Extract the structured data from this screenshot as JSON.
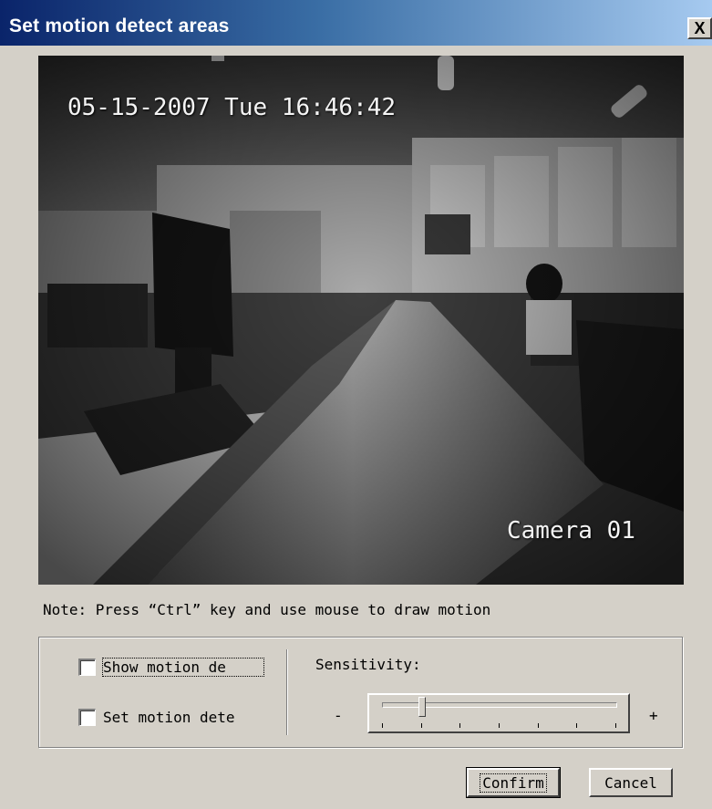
{
  "window": {
    "title": "Set motion detect areas",
    "close_label": "X"
  },
  "video": {
    "timestamp": "05-15-2007 Tue 16:46:42",
    "camera_label": "Camera 01"
  },
  "note": "Note: Press “Ctrl” key and use mouse to draw motion",
  "options": {
    "show_motion_label": "Show motion de",
    "show_motion_checked": false,
    "set_motion_label": "Set motion dete",
    "set_motion_checked": false
  },
  "sensitivity": {
    "label": "Sensitivity:",
    "minus": "-",
    "plus": "+",
    "level_fraction": 0.17,
    "tick_count": 7
  },
  "buttons": {
    "confirm": "Confirm",
    "cancel": "Cancel"
  }
}
